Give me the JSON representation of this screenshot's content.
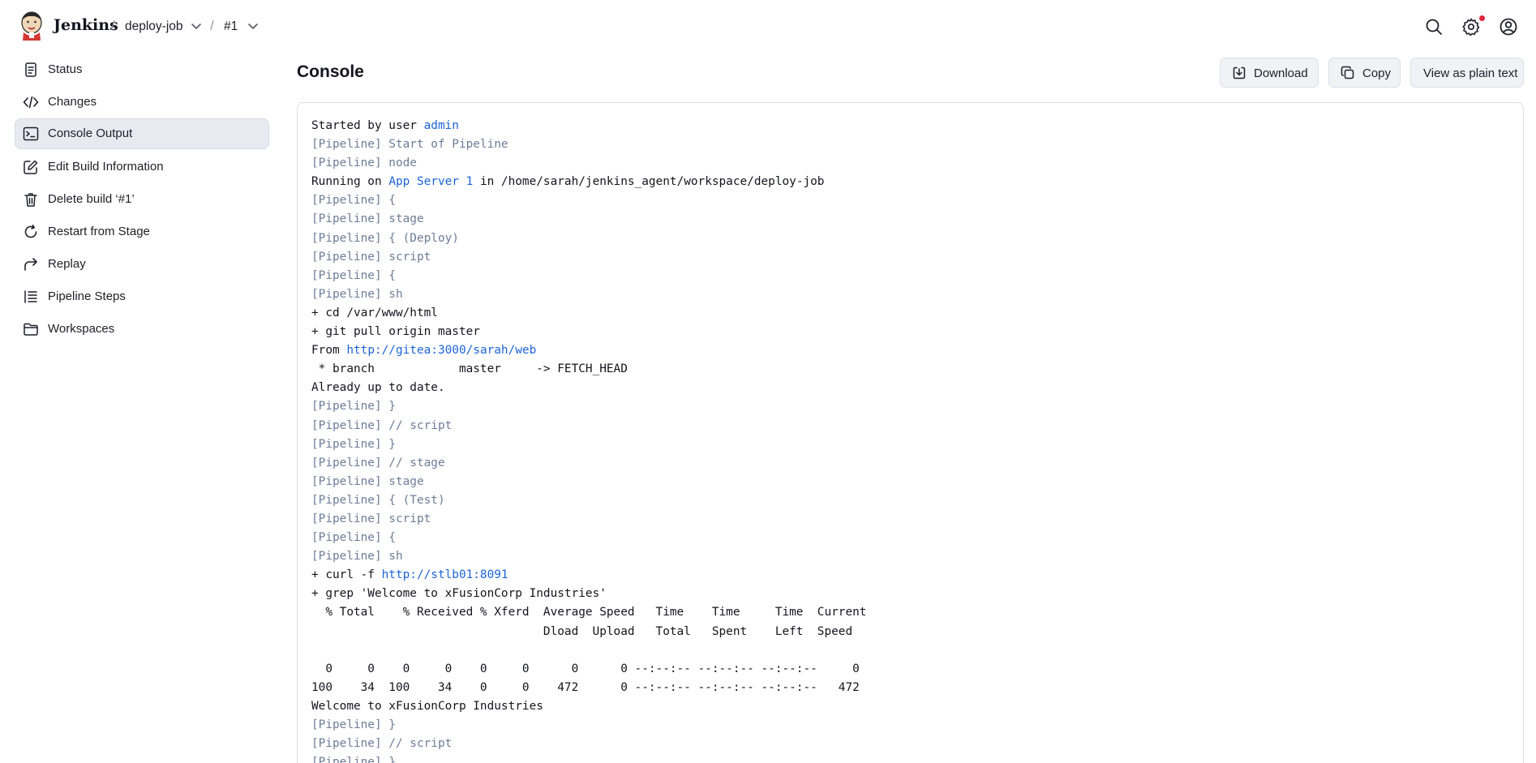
{
  "header": {
    "brand": "Jenkins",
    "breadcrumbs": [
      "deploy-job",
      "#1"
    ],
    "separator": "/"
  },
  "sidebar": {
    "items": [
      {
        "label": "Status",
        "icon": "status-icon",
        "active": false
      },
      {
        "label": "Changes",
        "icon": "code-icon",
        "active": false
      },
      {
        "label": "Console Output",
        "icon": "terminal-icon",
        "active": true
      },
      {
        "label": "Edit Build Information",
        "icon": "edit-icon",
        "active": false
      },
      {
        "label": "Delete build ‘#1’",
        "icon": "trash-icon",
        "active": false
      },
      {
        "label": "Restart from Stage",
        "icon": "restart-icon",
        "active": false
      },
      {
        "label": "Replay",
        "icon": "replay-icon",
        "active": false
      },
      {
        "label": "Pipeline Steps",
        "icon": "list-icon",
        "active": false
      },
      {
        "label": "Workspaces",
        "icon": "folder-icon",
        "active": false
      }
    ]
  },
  "main": {
    "title": "Console",
    "buttons": {
      "download": "Download",
      "copy": "Copy",
      "plain": "View as plain text"
    }
  },
  "console": {
    "lines": [
      {
        "t": "n",
        "parts": [
          {
            "text": "Started by user "
          },
          {
            "text": "admin",
            "link": true
          }
        ]
      },
      {
        "t": "p",
        "parts": [
          {
            "text": "[Pipeline] Start of Pipeline"
          }
        ]
      },
      {
        "t": "p",
        "parts": [
          {
            "text": "[Pipeline] node"
          }
        ]
      },
      {
        "t": "n",
        "parts": [
          {
            "text": "Running on "
          },
          {
            "text": "App Server 1",
            "link": true
          },
          {
            "text": " in /home/sarah/jenkins_agent/workspace/deploy-job"
          }
        ]
      },
      {
        "t": "p",
        "parts": [
          {
            "text": "[Pipeline] {"
          }
        ]
      },
      {
        "t": "p",
        "parts": [
          {
            "text": "[Pipeline] stage"
          }
        ]
      },
      {
        "t": "p",
        "parts": [
          {
            "text": "[Pipeline] { (Deploy)"
          }
        ]
      },
      {
        "t": "p",
        "parts": [
          {
            "text": "[Pipeline] script"
          }
        ]
      },
      {
        "t": "p",
        "parts": [
          {
            "text": "[Pipeline] {"
          }
        ]
      },
      {
        "t": "p",
        "parts": [
          {
            "text": "[Pipeline] sh"
          }
        ]
      },
      {
        "t": "n",
        "parts": [
          {
            "text": "+ cd /var/www/html"
          }
        ]
      },
      {
        "t": "n",
        "parts": [
          {
            "text": "+ git pull origin master"
          }
        ]
      },
      {
        "t": "n",
        "parts": [
          {
            "text": "From "
          },
          {
            "text": "http://gitea:3000/sarah/web",
            "link": true
          }
        ]
      },
      {
        "t": "n",
        "parts": [
          {
            "text": " * branch            master     -> FETCH_HEAD"
          }
        ]
      },
      {
        "t": "n",
        "parts": [
          {
            "text": "Already up to date."
          }
        ]
      },
      {
        "t": "p",
        "parts": [
          {
            "text": "[Pipeline] }"
          }
        ]
      },
      {
        "t": "p",
        "parts": [
          {
            "text": "[Pipeline] // script"
          }
        ]
      },
      {
        "t": "p",
        "parts": [
          {
            "text": "[Pipeline] }"
          }
        ]
      },
      {
        "t": "p",
        "parts": [
          {
            "text": "[Pipeline] // stage"
          }
        ]
      },
      {
        "t": "p",
        "parts": [
          {
            "text": "[Pipeline] stage"
          }
        ]
      },
      {
        "t": "p",
        "parts": [
          {
            "text": "[Pipeline] { (Test)"
          }
        ]
      },
      {
        "t": "p",
        "parts": [
          {
            "text": "[Pipeline] script"
          }
        ]
      },
      {
        "t": "p",
        "parts": [
          {
            "text": "[Pipeline] {"
          }
        ]
      },
      {
        "t": "p",
        "parts": [
          {
            "text": "[Pipeline] sh"
          }
        ]
      },
      {
        "t": "n",
        "parts": [
          {
            "text": "+ curl -f "
          },
          {
            "text": "http://stlb01:8091",
            "link": true
          }
        ]
      },
      {
        "t": "n",
        "parts": [
          {
            "text": "+ grep 'Welcome to xFusionCorp Industries'"
          }
        ]
      },
      {
        "t": "n",
        "parts": [
          {
            "text": "  % Total    % Received % Xferd  Average Speed   Time    Time     Time  Current"
          }
        ]
      },
      {
        "t": "n",
        "parts": [
          {
            "text": "                                 Dload  Upload   Total   Spent    Left  Speed"
          }
        ]
      },
      {
        "t": "n",
        "parts": [
          {
            "text": ""
          }
        ]
      },
      {
        "t": "n",
        "parts": [
          {
            "text": "  0     0    0     0    0     0      0      0 --:--:-- --:--:-- --:--:--     0"
          }
        ]
      },
      {
        "t": "n",
        "parts": [
          {
            "text": "100    34  100    34    0     0    472      0 --:--:-- --:--:-- --:--:--   472"
          }
        ]
      },
      {
        "t": "n",
        "parts": [
          {
            "text": "Welcome to xFusionCorp Industries"
          }
        ]
      },
      {
        "t": "p",
        "parts": [
          {
            "text": "[Pipeline] }"
          }
        ]
      },
      {
        "t": "p",
        "parts": [
          {
            "text": "[Pipeline] // script"
          }
        ]
      },
      {
        "t": "p",
        "parts": [
          {
            "text": "[Pipeline] }"
          }
        ]
      }
    ]
  },
  "colors": {
    "link": "#1d63d6",
    "pipeline": "#6d7d97",
    "active_bg": "#e8eaf1",
    "notification": "#e0253c"
  }
}
